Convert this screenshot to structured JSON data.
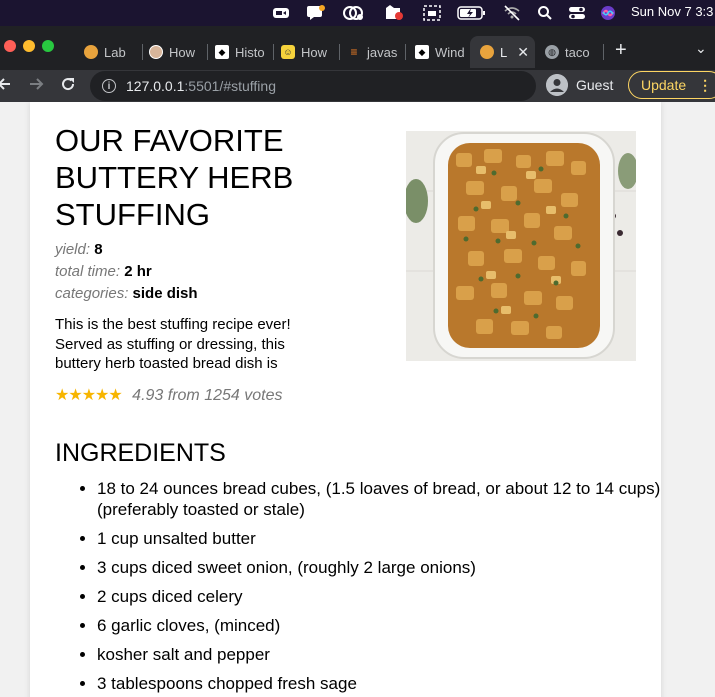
{
  "menubar": {
    "date_time": "Sun Nov 7  3:3"
  },
  "tabs": [
    {
      "label": "Lab",
      "icon": "orange-cookie-icon"
    },
    {
      "label": "How",
      "icon": "person-avatar-icon"
    },
    {
      "label": "Histo",
      "icon": "black-bird-icon"
    },
    {
      "label": "How",
      "icon": "yellow-smiley-icon"
    },
    {
      "label": "javas",
      "icon": "stack-overflow-icon"
    },
    {
      "label": "Wind",
      "icon": "black-bird-icon"
    },
    {
      "label": "L",
      "icon": "orange-cookie-icon",
      "active": true
    },
    {
      "label": "taco",
      "icon": "globe-icon"
    }
  ],
  "address_bar": {
    "host": "127.0.0.1",
    "path": ":5501/#stuffing"
  },
  "profile": {
    "label": "Guest"
  },
  "update_button": {
    "label": "Update"
  },
  "recipe": {
    "title": "OUR FAVORITE BUTTERY HERB STUFFING",
    "yield_label": "yield:",
    "yield_value": "8",
    "time_label": "total time:",
    "time_value": "2 hr",
    "categories_label": "categories:",
    "categories_value": "side dish",
    "description": "This is the best stuffing recipe ever! Served as stuffing or dressing, this buttery herb toasted bread dish is",
    "stars": "★★★★★",
    "rating_text": "4.93 from 1254 votes",
    "rating_value": 4.93,
    "ingredients_heading": "INGREDIENTS",
    "ingredients": [
      "18 to 24 ounces bread cubes, (1.5 loaves of bread, or about 12 to 14 cups) (preferably toasted or stale)",
      "1 cup unsalted butter",
      "3 cups diced sweet onion, (roughly 2 large onions)",
      "2 cups diced celery",
      "6 garlic cloves, (minced)",
      "kosher salt and pepper",
      "3 tablespoons chopped fresh sage"
    ]
  },
  "colors": {
    "update_accent": "#fdd663",
    "star_color": "#f7b500",
    "tab_bar": "#202124",
    "toolbar": "#35363a"
  }
}
